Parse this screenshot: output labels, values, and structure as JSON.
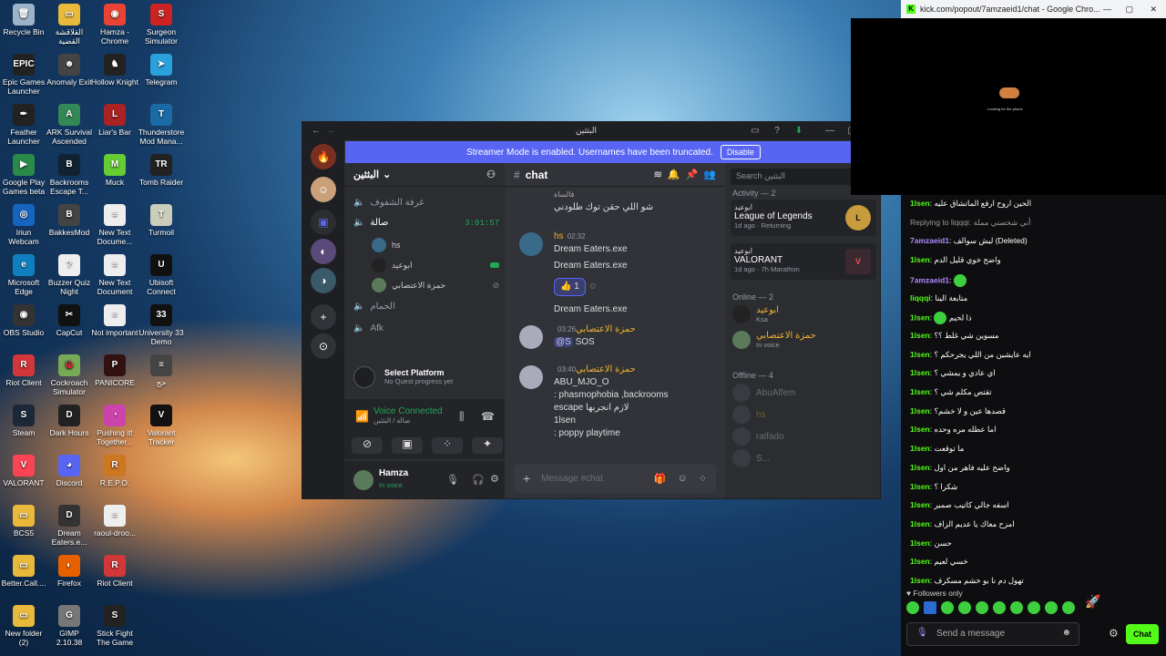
{
  "desktop_icons": [
    {
      "label": "Recycle Bin",
      "color": "#9db3c9",
      "glyph": "🗑"
    },
    {
      "label": "Epic Games Launcher",
      "color": "#222",
      "glyph": "EPIC"
    },
    {
      "label": "Feather Launcher",
      "color": "#222",
      "glyph": "✒"
    },
    {
      "label": "Google Play Games beta",
      "color": "#2a8a4a",
      "glyph": "▶"
    },
    {
      "label": "Iriun Webcam",
      "color": "#1565c0",
      "glyph": "◎"
    },
    {
      "label": "Microsoft Edge",
      "color": "#0f7fbf",
      "glyph": "e"
    },
    {
      "label": "OBS Studio",
      "color": "#333",
      "glyph": "◉"
    },
    {
      "label": "Riot Client",
      "color": "#d13639",
      "glyph": "R"
    },
    {
      "label": "Steam",
      "color": "#1b2838",
      "glyph": "S"
    },
    {
      "label": "VALORANT",
      "color": "#fa4454",
      "glyph": "V"
    },
    {
      "label": "BCS5",
      "color": "#e8b93a",
      "glyph": "▭"
    },
    {
      "label": "Better.Call....",
      "color": "#e8b93a",
      "glyph": "▭"
    },
    {
      "label": "New folder (2)",
      "color": "#e8b93a",
      "glyph": "▭"
    },
    {
      "label": "القلاقشة القضية",
      "color": "#e8b93a",
      "glyph": "▭"
    },
    {
      "label": "Anomaly Exit",
      "color": "#444",
      "glyph": "☻"
    },
    {
      "label": "ARK Survival Ascended",
      "color": "#385",
      "glyph": "A"
    },
    {
      "label": "Backrooms Escape T...",
      "color": "#123",
      "glyph": "B"
    },
    {
      "label": "BakkesMod",
      "color": "#444",
      "glyph": "B"
    },
    {
      "label": "Buzzer Quiz Night",
      "color": "#eee",
      "glyph": "?"
    },
    {
      "label": "CapCut",
      "color": "#111",
      "glyph": "✂"
    },
    {
      "label": "Cockroach Simulator",
      "color": "#7a5",
      "glyph": "🐞"
    },
    {
      "label": "Dark Hours",
      "color": "#222",
      "glyph": "D"
    },
    {
      "label": "Discord",
      "color": "#5865f2",
      "glyph": "◕"
    },
    {
      "label": "Dream Eaters.e...",
      "color": "#333",
      "glyph": "D"
    },
    {
      "label": "Firefox",
      "color": "#e66000",
      "glyph": "◐"
    },
    {
      "label": "GIMP 2.10.38",
      "color": "#777",
      "glyph": "G"
    },
    {
      "label": "Hamza - Chrome",
      "color": "#ea4335",
      "glyph": "◉"
    },
    {
      "label": "Hollow Knight",
      "color": "#222",
      "glyph": "♞"
    },
    {
      "label": "Liar's Bar",
      "color": "#a22",
      "glyph": "L"
    },
    {
      "label": "Muck",
      "color": "#6c3",
      "glyph": "M"
    },
    {
      "label": "New Text Docume...",
      "color": "#eee",
      "glyph": "≡"
    },
    {
      "label": "New Text Document",
      "color": "#eee",
      "glyph": "≡"
    },
    {
      "label": "Not important",
      "color": "#eee",
      "glyph": "≡"
    },
    {
      "label": "PANICORE",
      "color": "#311",
      "glyph": "P"
    },
    {
      "label": "Pushing it! Together...",
      "color": "#c4a",
      "glyph": "◔"
    },
    {
      "label": "R.E.P.O.",
      "color": "#c72",
      "glyph": "R"
    },
    {
      "label": "raoul-droo...",
      "color": "#eee",
      "glyph": "≡"
    },
    {
      "label": "Riot Client",
      "color": "#d13639",
      "glyph": "R"
    },
    {
      "label": "Stick Fight The Game",
      "color": "#222",
      "glyph": "S"
    },
    {
      "label": "Surgeon Simulator",
      "color": "#c22",
      "glyph": "S"
    },
    {
      "label": "Telegram",
      "color": "#2aa1da",
      "glyph": "➤"
    },
    {
      "label": "Thunderstore Mod Mana...",
      "color": "#1a6aa5",
      "glyph": "T"
    },
    {
      "label": "Tomb Raider",
      "color": "#222",
      "glyph": "TR"
    },
    {
      "label": "Turmoil",
      "color": "#ccb",
      "glyph": "T"
    },
    {
      "label": "Ubisoft Connect",
      "color": "#111",
      "glyph": "U"
    },
    {
      "label": "University 33 Demo",
      "color": "#111",
      "glyph": "33"
    },
    {
      "label": "حج",
      "color": "#444",
      "glyph": "≡"
    },
    {
      "label": "Valorant Tracker",
      "color": "#111",
      "glyph": "V"
    }
  ],
  "discord": {
    "window_title": "البثثين",
    "banner": {
      "text": "Streamer Mode is enabled. Usernames have been truncated.",
      "button": "Disable"
    },
    "server_name": "البثثين",
    "channels": {
      "c1": "غرفة الشفوف",
      "c2": "صالة",
      "c2_timer": "3:01:57",
      "users": [
        "hs",
        "ابوعيد",
        "حمزة الاعتصابي"
      ],
      "c3": "الحمام",
      "c4": "Afk"
    },
    "quest": {
      "title": "Select Platform",
      "sub": "No Quest progress yet"
    },
    "voice": {
      "title": "Voice Connected",
      "sub": "صالة / البثثين"
    },
    "user": {
      "name": "Hamza",
      "status": "In voice"
    },
    "chat_channel": "chat",
    "search_placeholder": "Search البثثين",
    "messages": [
      {
        "text1": "فالساة",
        "text2": "شو اللي حقن توك طلودني"
      },
      {
        "name": "hs",
        "time": "02:32",
        "lines": [
          "Dream Eaters.exe",
          "Dream Eaters.exe"
        ],
        "reaction": "1",
        "line3": "Dream Eaters.exe"
      },
      {
        "name": "حمزة الاعتصابي",
        "time": "03:26",
        "mention": "@S",
        "text": "SOS"
      },
      {
        "name": "حمزة الاعتصابي",
        "time": "03:40",
        "lines": [
          "ABU_MJO_O",
          ": phasmophobia ,backrooms",
          "escape لازم انجربها",
          "1lsen",
          ": poppy playtime"
        ]
      }
    ],
    "message_placeholder": "Message #chat",
    "members": {
      "activity_header": "Activity — 2",
      "activities": [
        {
          "user": "ابوعيد",
          "game": "League of Legends",
          "meta": "1d ago",
          "extra": "Returning"
        },
        {
          "user": "ابوعيد",
          "game": "VALORANT",
          "meta": "1d ago",
          "extra": "7h Marathon"
        }
      ],
      "online_header": "Online — 2",
      "online": [
        {
          "name": "ابوعيد",
          "sub": "Ksa"
        },
        {
          "name": "حمزة الاعتصابي",
          "sub": "In voice"
        }
      ],
      "offline_header": "Offline — 4",
      "offline": [
        "AbuAlfem",
        "hs",
        "ralfado",
        "S..."
      ]
    }
  },
  "kick": {
    "title": "kick.com/popout/7amzaeid1/chat - Google Chro...",
    "video_caption": "Looking for the phone",
    "chat": [
      {
        "u": "1lsen",
        "t": "الحين اروح ارفع الماتشاق عليه"
      },
      {
        "u": "",
        "t": "Replying to liqqqi: أني شخصتي مملة"
      },
      {
        "u": "7amzaeid1",
        "t": "ليش سوالف (Deleted)",
        "purple": true
      },
      {
        "u": "1lsen",
        "t": "واضح خوي قليل الدم"
      },
      {
        "u": "7amzaeid1",
        "t": "",
        "purple": true,
        "emote": true
      },
      {
        "u": "liqqqi",
        "t": "متابعة الينا"
      },
      {
        "u": "1lsen",
        "t": "ذا لحيم",
        "emote": true
      },
      {
        "u": "1lsen",
        "t": "مسوين شي غلط ؟؟"
      },
      {
        "u": "1lsen",
        "t": "ايه عايشين من اللي يجرحكم ؟"
      },
      {
        "u": "1lsen",
        "t": "اي عادي و يمشي ؟"
      },
      {
        "u": "1lsen",
        "t": "تقتص مكلم شي ؟"
      },
      {
        "u": "1lsen",
        "t": "قصدها عين و لا خشم؟"
      },
      {
        "u": "1lsen",
        "t": "اما عطله مره وحده"
      },
      {
        "u": "1lsen",
        "t": "ما توقعت"
      },
      {
        "u": "1lsen",
        "t": "واضح عليه فاهر من اول"
      },
      {
        "u": "1lsen",
        "t": "شكرا ؟"
      },
      {
        "u": "1lsen",
        "t": "اسفه جالي كاتيب صمير"
      },
      {
        "u": "1lsen",
        "t": "امزح معاك يا عديم الزاف"
      },
      {
        "u": "1lsen",
        "t": "حسن"
      },
      {
        "u": "1lsen",
        "t": "خسي لعيم"
      },
      {
        "u": "1lsen",
        "t": "تهول دم نا بو خشم مسكرف"
      }
    ],
    "followers_only": "Followers only",
    "input_placeholder": "Send a message",
    "chat_button": "Chat"
  }
}
